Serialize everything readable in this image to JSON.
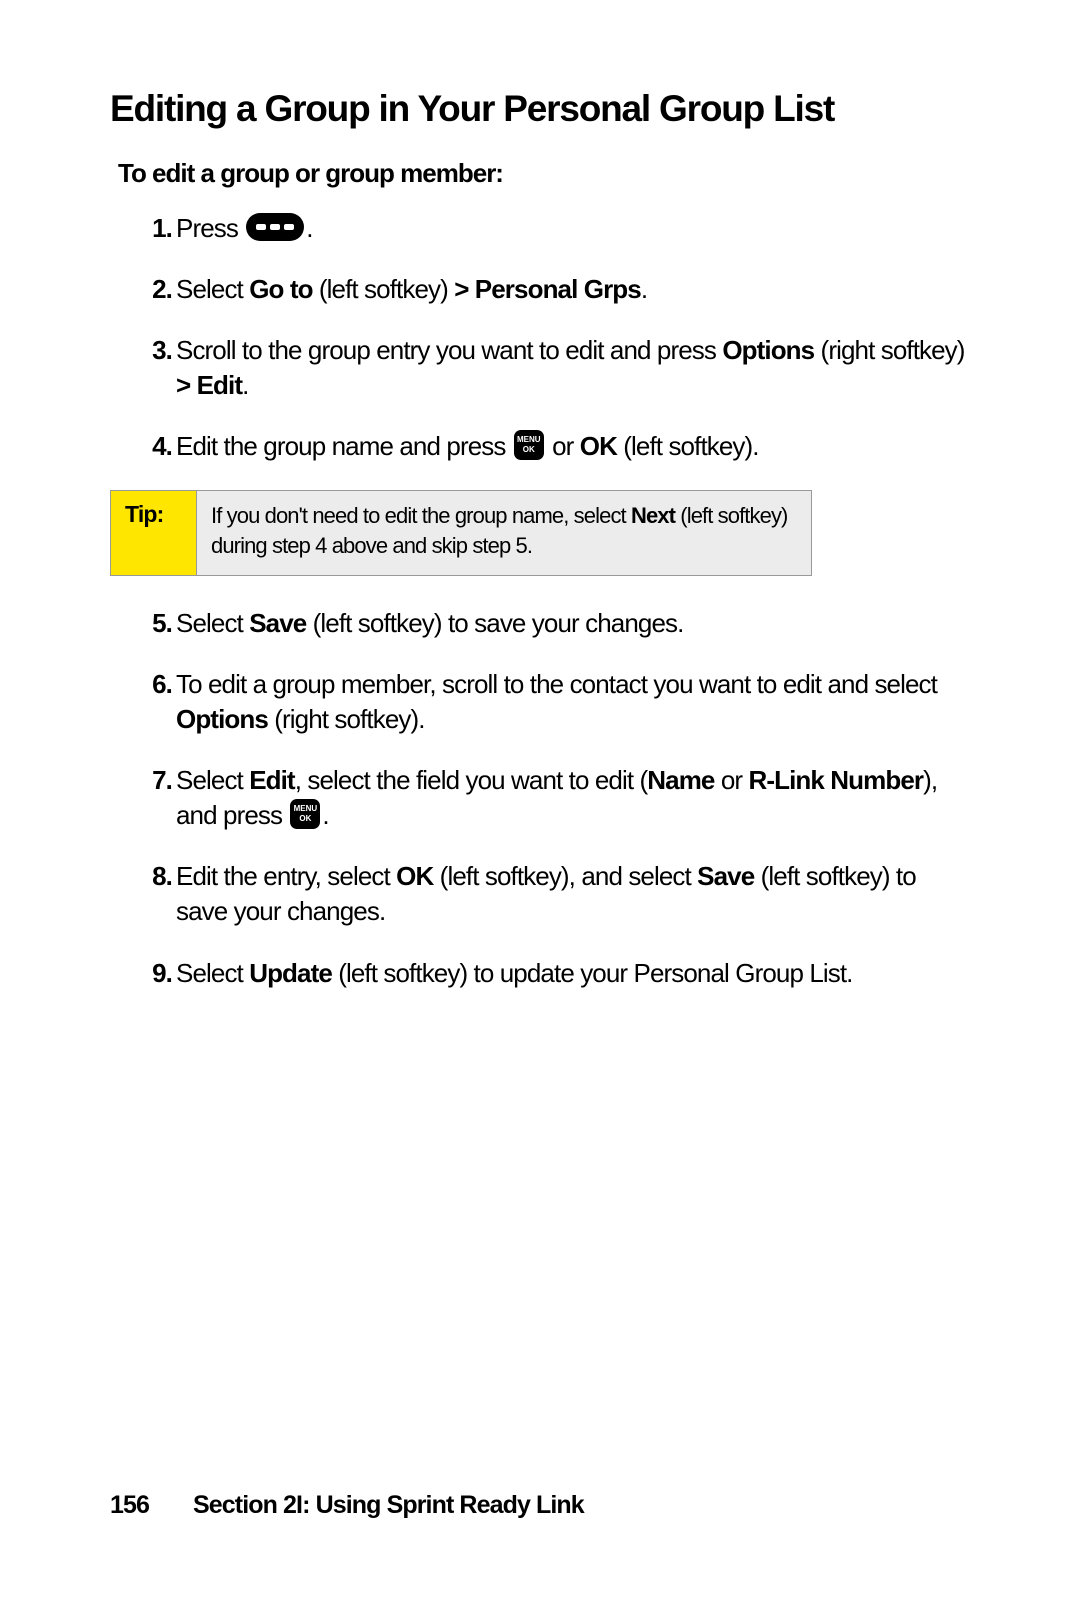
{
  "heading": "Editing a Group in Your Personal Group List",
  "subheading": "To edit a group or group member:",
  "steps": {
    "s1": {
      "num": "1.",
      "a": "Press ",
      "b": "."
    },
    "s2": {
      "num": "2.",
      "a": "Select ",
      "b": "Go to",
      "c": " (left softkey) ",
      "d": "> Personal Grps",
      "e": "."
    },
    "s3": {
      "num": "3.",
      "a": "Scroll to the group entry you want to edit and press ",
      "b": "Options",
      "c": " (right softkey) ",
      "d": "> Edit",
      "e": "."
    },
    "s4": {
      "num": "4.",
      "a": "Edit the group name and press ",
      "b": " or ",
      "c": "OK",
      "d": " (left softkey)."
    },
    "s5": {
      "num": "5.",
      "a": "Select ",
      "b": "Save",
      "c": " (left softkey) to save your changes."
    },
    "s6": {
      "num": "6.",
      "a": "To edit a group member, scroll to the contact you want to edit and select ",
      "b": "Options",
      "c": " (right softkey)."
    },
    "s7": {
      "num": "7.",
      "a": "Select ",
      "b": "Edit",
      "c": ", select the field you want to edit (",
      "d": "Name",
      "e": " or ",
      "f": "R-Link Number",
      "g": "), and press ",
      "h": "."
    },
    "s8": {
      "num": "8.",
      "a": "Edit the entry, select ",
      "b": "OK",
      "c": " (left softkey), and select ",
      "d": "Save",
      "e": " (left softkey) to save your changes."
    },
    "s9": {
      "num": "9.",
      "a": "Select ",
      "b": "Update",
      "c": " (left softkey) to update your Personal Group List."
    }
  },
  "tip": {
    "label": "Tip:",
    "a": "If you don't need to edit the group name, select ",
    "b": "Next",
    "c": " (left softkey) during step 4 above and skip step 5."
  },
  "footer": {
    "page": "156",
    "section": "Section 2I: Using Sprint Ready Link"
  },
  "icons": {
    "menu_top": "MENU",
    "menu_bot": "OK"
  }
}
